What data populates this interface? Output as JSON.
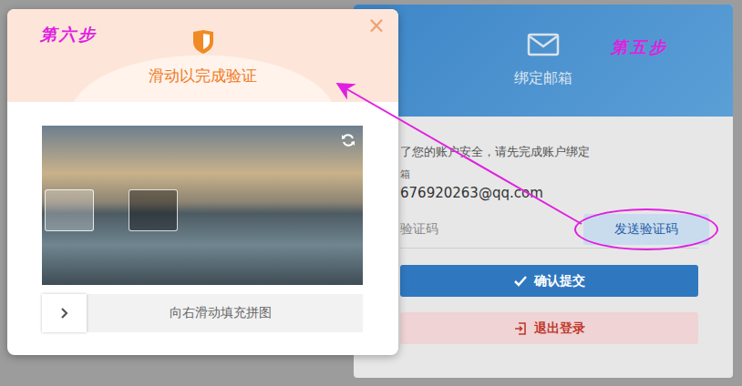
{
  "steps": {
    "modal": "第六步",
    "card": "第五步"
  },
  "card": {
    "title": "绑定邮箱",
    "notice": "了您的账户安全，请先完成账户绑定",
    "email_label": "箱",
    "email": "676920263@qq.com",
    "code_placeholder": "验证码",
    "send_button": {
      "label": "发送验证码",
      "highlighted": true
    },
    "submit_button": "确认提交",
    "logout_button": "退出登录"
  },
  "modal": {
    "title": "滑动以完成验证",
    "close": "×",
    "slider": {
      "hint": "向右滑动填充拼图",
      "level": 0
    }
  }
}
